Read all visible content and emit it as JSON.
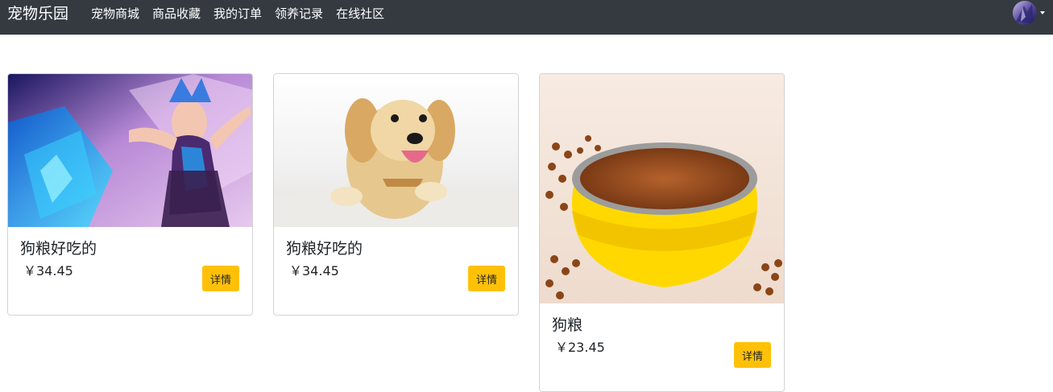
{
  "navbar": {
    "brand": "宠物乐园",
    "links": [
      "宠物商城",
      "商品收藏",
      "我的订单",
      "领养记录",
      "在线社区"
    ]
  },
  "products": [
    {
      "title": "狗粮好吃的",
      "price": "￥34.45",
      "button": "详情"
    },
    {
      "title": "狗粮好吃的",
      "price": "￥34.45",
      "button": "详情"
    },
    {
      "title": "狗粮",
      "price": "￥23.45",
      "button": "详情"
    }
  ],
  "colors": {
    "navbar_bg": "#343a40",
    "button_bg": "#ffc107",
    "card_border": "#d3d3d3"
  }
}
